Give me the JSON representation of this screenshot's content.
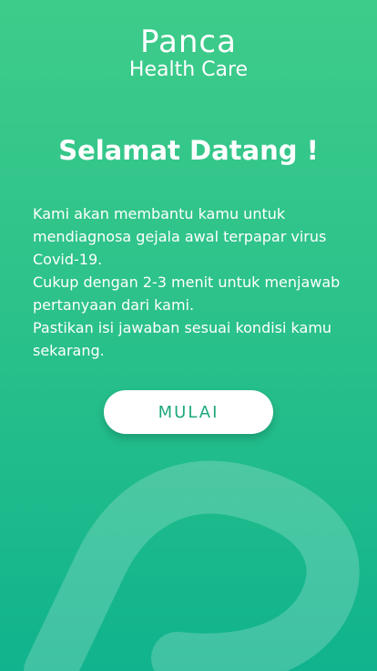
{
  "app": {
    "brand": "Panca",
    "subtitle": "Health Care"
  },
  "welcome": {
    "title": "Selamat Datang !",
    "lines": [
      "Kami akan membantu kamu untuk mendiagnosa gejala awal terpapar virus Covid-19.",
      "Cukup dengan 2-3 menit untuk menjawab pertanyaan dari kami.",
      "Pastikan isi jawaban sesuai kondisi kamu sekarang."
    ]
  },
  "actions": {
    "start_label": "MULAI"
  },
  "colors": {
    "gradient_top": "#3ECC8A",
    "gradient_bottom": "#10B38D",
    "button_text": "#1FA87E",
    "text": "#FFFFFF"
  },
  "icons": {
    "background_mark": "brand-p-mark"
  }
}
